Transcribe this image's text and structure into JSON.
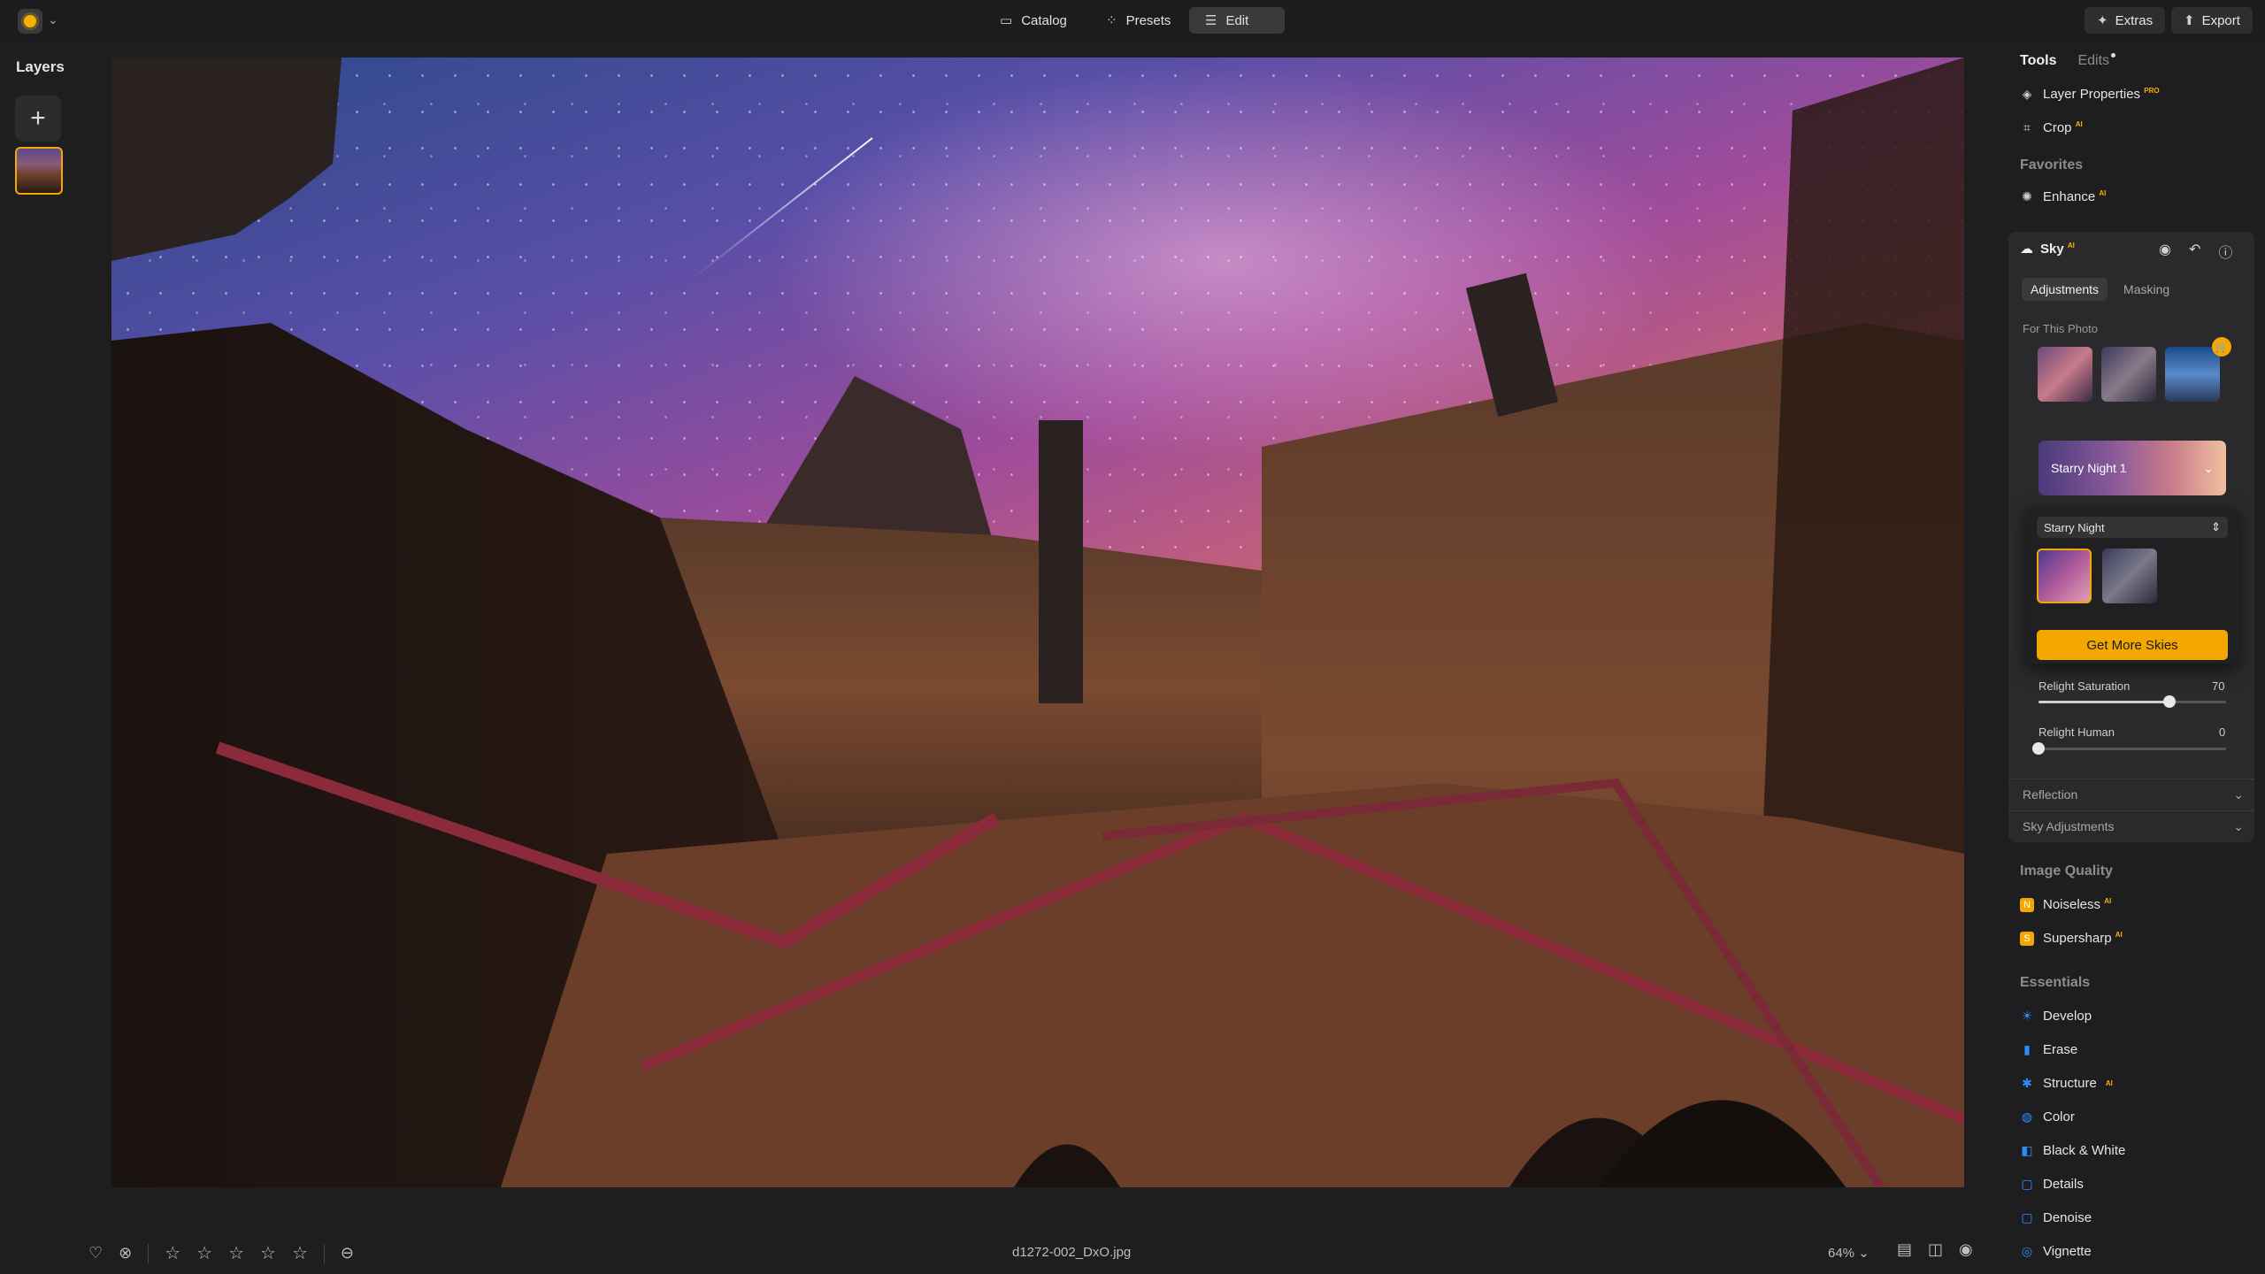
{
  "topbar": {
    "nav": [
      {
        "label": "Catalog",
        "icon": "folder-icon"
      },
      {
        "label": "Presets",
        "icon": "presets-icon"
      },
      {
        "label": "Edit",
        "icon": "sliders-icon"
      }
    ],
    "extras_label": "Extras",
    "export_label": "Export"
  },
  "layers": {
    "title": "Layers"
  },
  "bottom": {
    "filename": "d1272-002_DxO.jpg",
    "zoom": "64%",
    "rating": 0,
    "stars_total": 5
  },
  "panel": {
    "tabs": {
      "tools": "Tools",
      "edits": "Edits"
    },
    "layer_properties": "Layer Properties",
    "layer_properties_badge": "PRO",
    "crop": "Crop",
    "ai_badge": "AI",
    "favorites_title": "Favorites",
    "enhance": "Enhance",
    "sky": {
      "title": "Sky",
      "adjustments_tab": "Adjustments",
      "masking_tab": "Masking",
      "for_this_photo": "For This Photo",
      "selected_sky": "Starry Night 1",
      "popover": {
        "category": "Starry Night",
        "get_more": "Get More Skies"
      },
      "relight_saturation_label": "Relight Saturation",
      "relight_saturation_value": "70",
      "relight_saturation_fraction": 0.7,
      "relight_human_label": "Relight Human",
      "relight_human_value": "0",
      "relight_human_fraction": 0.0,
      "reflection": "Reflection",
      "sky_adjustments": "Sky Adjustments"
    },
    "image_quality_title": "Image Quality",
    "noiseless": "Noiseless",
    "supersharp": "Supersharp",
    "essentials_title": "Essentials",
    "essentials": [
      {
        "label": "Develop",
        "icon": "develop-icon",
        "color": "#2f8cff"
      },
      {
        "label": "Erase",
        "icon": "erase-icon",
        "color": "#2f8cff"
      },
      {
        "label": "Structure",
        "icon": "structure-icon",
        "color": "#2f8cff",
        "ai": true
      },
      {
        "label": "Color",
        "icon": "color-icon",
        "color": "#2f8cff"
      },
      {
        "label": "Black & White",
        "icon": "black-white-icon",
        "color": "#2f8cff"
      },
      {
        "label": "Details",
        "icon": "details-icon",
        "color": "#2f8cff"
      },
      {
        "label": "Denoise",
        "icon": "denoise-icon",
        "color": "#2f8cff"
      },
      {
        "label": "Vignette",
        "icon": "vignette-icon",
        "color": "#2f8cff"
      }
    ]
  },
  "colors": {
    "accent": "#f3a700",
    "panel_bg": "#2a2a2c",
    "app_bg": "#1e1e20"
  }
}
